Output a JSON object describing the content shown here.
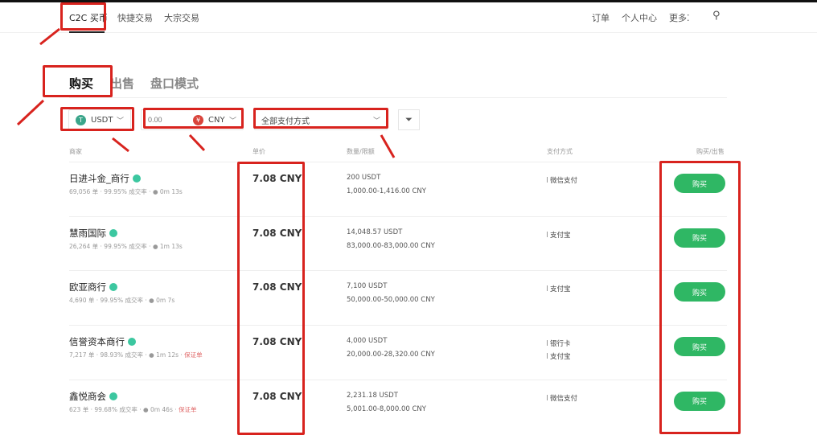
{
  "nav": {
    "items": [
      "C2C 买币",
      "快捷交易",
      "大宗交易"
    ],
    "right": [
      "订单",
      "个人中心",
      "更多"
    ]
  },
  "tabs": [
    "购买",
    "出售",
    "盘口模式"
  ],
  "filters": {
    "crypto": "USDT",
    "amount_placeholder": "0.00",
    "fiat": "CNY",
    "payment": "全部支付方式"
  },
  "columns": [
    "商家",
    "单价",
    "数量/限额",
    "支付方式",
    "购买/出售"
  ],
  "rows": [
    {
      "name": "日进斗金_商行",
      "orders": "69,056 单",
      "rate": "99.95% 成交率",
      "time": "0m 13s",
      "deposit": "",
      "price": "7.08 CNY",
      "qty": "200 USDT",
      "limit": "1,000.00-1,416.00 CNY",
      "payments": [
        "微信支付"
      ],
      "action": "购买"
    },
    {
      "name": "慧雨国际",
      "orders": "26,264 单",
      "rate": "99.95% 成交率",
      "time": "1m 13s",
      "deposit": "",
      "price": "7.08 CNY",
      "qty": "14,048.57 USDT",
      "limit": "83,000.00-83,000.00 CNY",
      "payments": [
        "支付宝"
      ],
      "action": "购买"
    },
    {
      "name": "欧亚商行",
      "orders": "4,690 单",
      "rate": "99.95% 成交率",
      "time": "0m 7s",
      "deposit": "",
      "price": "7.08 CNY",
      "qty": "7,100 USDT",
      "limit": "50,000.00-50,000.00 CNY",
      "payments": [
        "支付宝"
      ],
      "action": "购买"
    },
    {
      "name": "信誉资本商行",
      "orders": "7,217 单",
      "rate": "98.93% 成交率",
      "time": "1m 12s",
      "deposit": "保证单",
      "price": "7.08 CNY",
      "qty": "4,000 USDT",
      "limit": "20,000.00-28,320.00 CNY",
      "payments": [
        "银行卡",
        "支付宝"
      ],
      "action": "购买"
    },
    {
      "name": "鑫悦商会",
      "orders": "623 单",
      "rate": "99.68% 成交率",
      "time": "0m 46s",
      "deposit": "保证单",
      "price": "7.08 CNY",
      "qty": "2,231.18 USDT",
      "limit": "5,001.00-8,000.00 CNY",
      "payments": [
        "微信支付"
      ],
      "action": "购买"
    }
  ],
  "colors": {
    "accent": "#2fb764",
    "annotation": "#d8231e"
  }
}
